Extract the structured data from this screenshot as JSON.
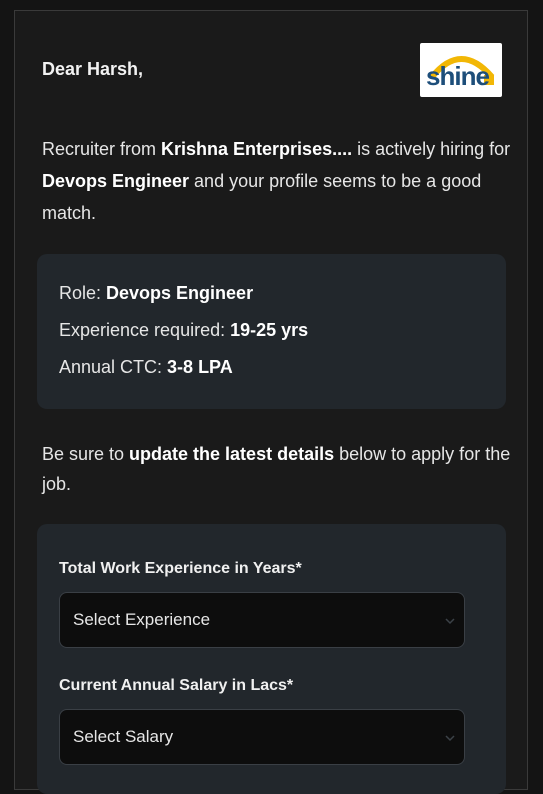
{
  "greeting": "Dear Harsh,",
  "logo": {
    "brand": "shine",
    "brand_suffix": ".com"
  },
  "intro": {
    "p1": "Recruiter from ",
    "company": "Krishna Enterprises....",
    "p2": " is actively hiring for ",
    "role": "Devops Engineer",
    "p3": " and your profile seems to be a good match."
  },
  "job": {
    "role_label": "Role: ",
    "role_value": "Devops Engineer",
    "experience_label": "Experience required: ",
    "experience_value": "19-25 yrs",
    "ctc_label": "Annual CTC: ",
    "ctc_value": "3-8 LPA"
  },
  "update": {
    "p1": "Be sure to ",
    "bold": "update the latest details",
    "p2": " below to apply for the job."
  },
  "form": {
    "experience_label": "Total Work Experience in Years*",
    "experience_selected": "Select Experience",
    "salary_label": "Current Annual Salary in Lacs*",
    "salary_selected": "Select Salary"
  },
  "colors": {
    "background": "#141414",
    "card": "#22272c",
    "select_bg": "#0d0d0d",
    "logo_arc": "#f2b705",
    "logo_text": "#1d4e7a"
  }
}
